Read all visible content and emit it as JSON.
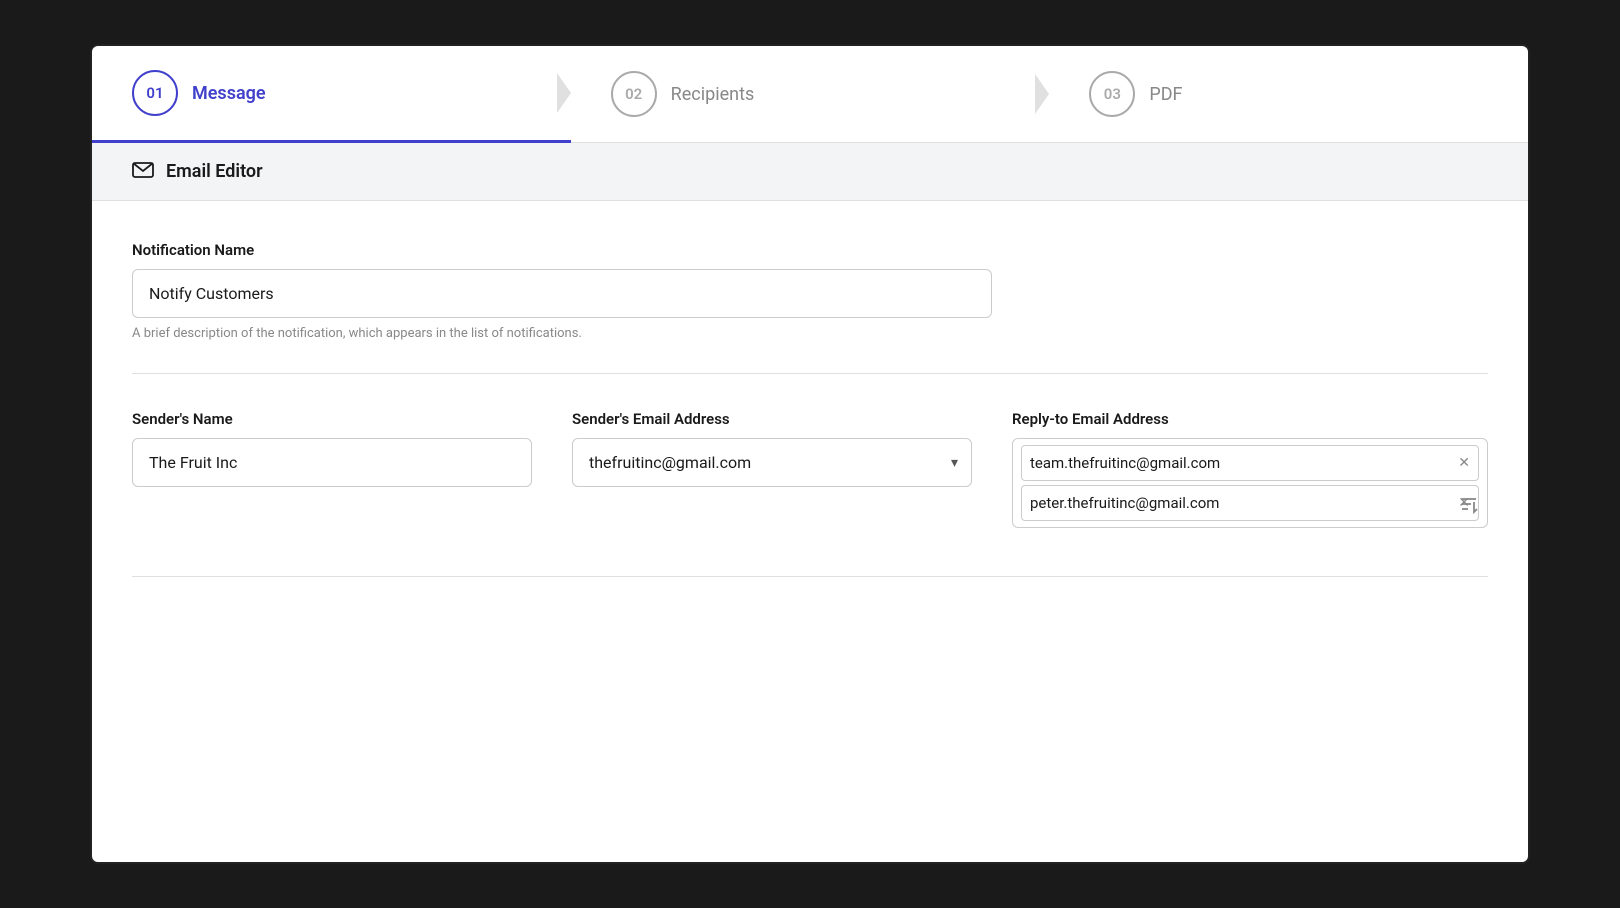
{
  "stepper": {
    "steps": [
      {
        "number": "01",
        "label": "Message",
        "active": true
      },
      {
        "number": "02",
        "label": "Recipients",
        "active": false
      },
      {
        "number": "03",
        "label": "PDF",
        "active": false
      }
    ]
  },
  "section": {
    "header": "Email Editor"
  },
  "form": {
    "notification_name_label": "Notification Name",
    "notification_name_value": "Notify Customers",
    "notification_name_hint": "A brief description of the notification, which appears in the list of notifications.",
    "sender_name_label": "Sender's Name",
    "sender_name_value": "The Fruit Inc",
    "sender_email_label": "Sender's Email Address",
    "sender_email_value": "thefruitinc@gmail.com",
    "reply_to_label": "Reply-to Email Address",
    "reply_to_items": [
      {
        "email": "team.thefruitinc@gmail.com"
      },
      {
        "email": "peter.thefruitinc@gmail.com"
      }
    ]
  },
  "colors": {
    "active": "#4040cc",
    "inactive": "#aaaaaa",
    "border": "#cccccc",
    "text_dark": "#1a1a1a",
    "text_hint": "#888888"
  }
}
